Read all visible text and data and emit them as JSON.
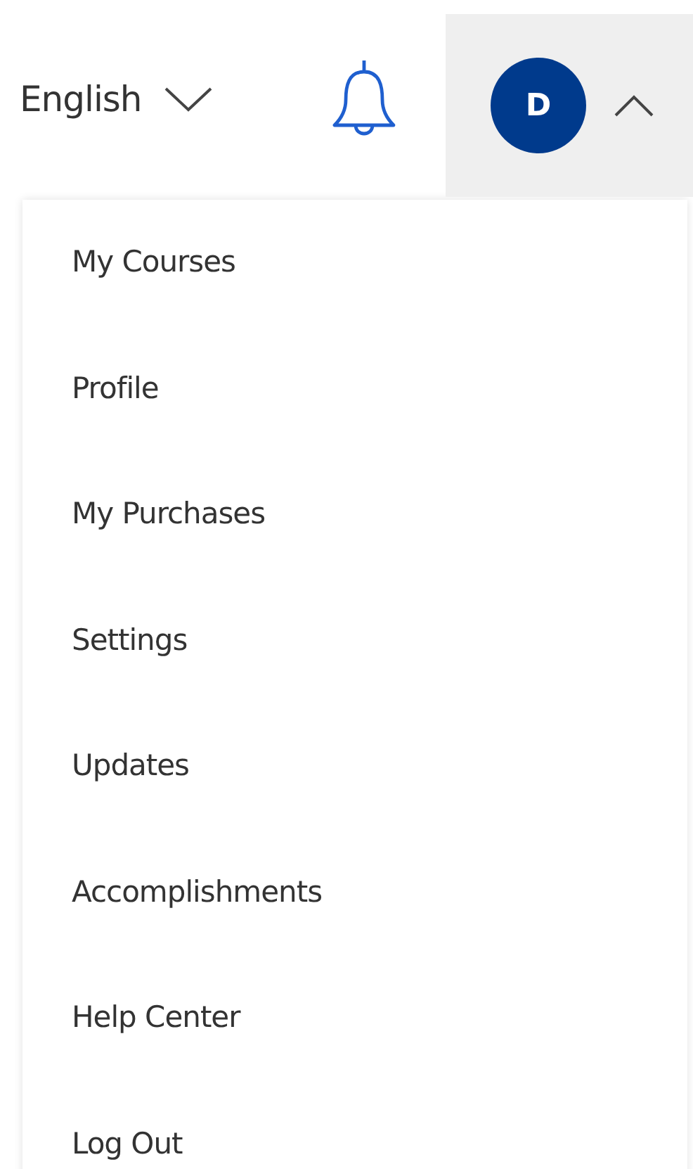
{
  "language": {
    "label": "English"
  },
  "account": {
    "initial": "D",
    "expanded": true
  },
  "menu": [
    {
      "label": "My Courses"
    },
    {
      "label": "Profile"
    },
    {
      "label": "My Purchases"
    },
    {
      "label": "Settings"
    },
    {
      "label": "Updates"
    },
    {
      "label": "Accomplishments"
    },
    {
      "label": "Help Center"
    },
    {
      "label": "Log Out"
    }
  ]
}
